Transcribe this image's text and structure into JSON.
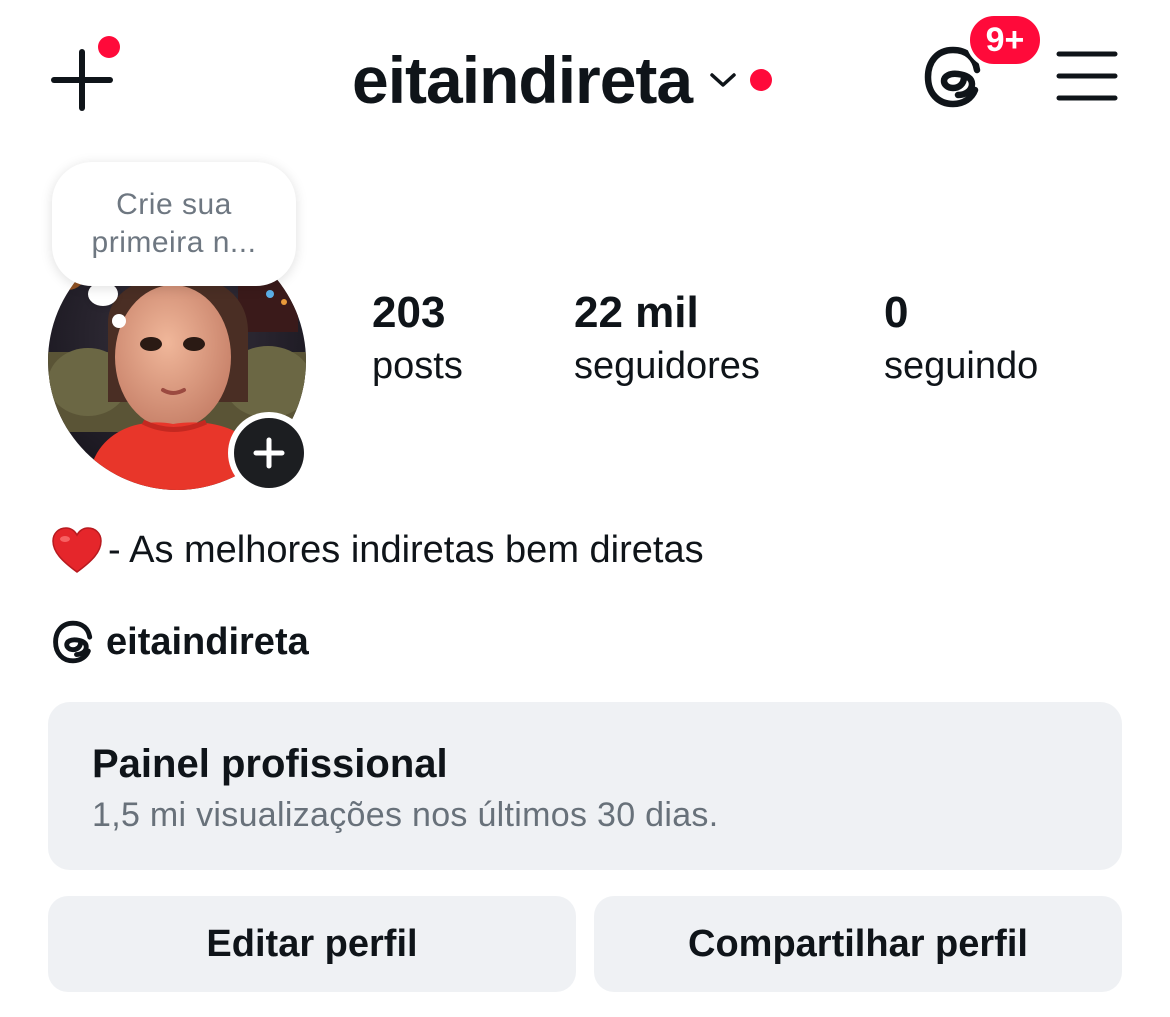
{
  "header": {
    "create_icon": "plus-icon",
    "username": "eitaindireta",
    "threads_icon": "threads-icon",
    "notification_badge": "9+",
    "menu_icon": "hamburger-menu-icon",
    "accent_color": "#ff0a3a"
  },
  "note": {
    "text_line1": "Crie sua",
    "text_line2": "primeira n..."
  },
  "profile": {
    "avatar": "profile-avatar-image",
    "add_story_icon": "plus-icon"
  },
  "stats": {
    "posts": {
      "value": "203",
      "label": "posts"
    },
    "followers": {
      "value": "22 mil",
      "label": "seguidores"
    },
    "following": {
      "value": "0",
      "label": "seguindo"
    }
  },
  "bio": {
    "emoji_icon": "red-heart-icon",
    "text": "- As melhores indiretas bem diretas"
  },
  "threads_link": {
    "icon": "threads-icon",
    "handle": "eitaindireta"
  },
  "professional_dashboard": {
    "title": "Painel profissional",
    "subtitle": "1,5 mi visualizações nos últimos 30 dias."
  },
  "actions": {
    "edit_label": "Editar perfil",
    "share_label": "Compartilhar perfil"
  }
}
